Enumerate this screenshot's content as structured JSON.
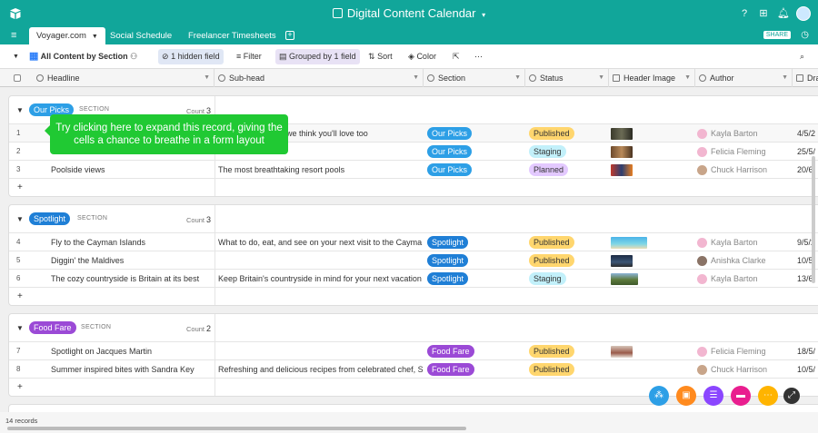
{
  "app": {
    "title": "Digital Content Calendar"
  },
  "tabs": [
    {
      "label": "Voyager.com",
      "active": true
    },
    {
      "label": "Social Schedule",
      "active": false
    },
    {
      "label": "Freelancer Timesheets",
      "active": false
    }
  ],
  "share_label": "SHARE",
  "toolbar": {
    "view_name": "All Content by Section",
    "hidden_fields": "1 hidden field",
    "filter": "Filter",
    "grouped": "Grouped by 1 field",
    "sort": "Sort",
    "color": "Color"
  },
  "columns": [
    "Headline",
    "Sub-head",
    "Section",
    "Status",
    "Header Image",
    "Author",
    "Dra"
  ],
  "group_section_label": "SECTION",
  "count_label": "Count",
  "groups": [
    {
      "name": "Our Picks",
      "color": "#2d9fe6",
      "count": "3",
      "rows": [
        {
          "num": "1",
          "headline": "",
          "subhead": "we think you'll love too",
          "section": "Our Picks",
          "status": "Published",
          "author": "Kayla Barton",
          "date": "4/5/2"
        },
        {
          "num": "2",
          "headline": "",
          "subhead": "",
          "section": "Our Picks",
          "status": "Staging",
          "author": "Felicia Fleming",
          "date": "25/5/"
        },
        {
          "num": "3",
          "headline": "Poolside views",
          "subhead": "The most breathtaking resort pools",
          "section": "Our Picks",
          "status": "Planned",
          "author": "Chuck Harrison",
          "date": "20/6/"
        }
      ]
    },
    {
      "name": "Spotlight",
      "color": "#1f7fd6",
      "count": "3",
      "rows": [
        {
          "num": "4",
          "headline": "Fly to the Cayman Islands",
          "subhead": "What to do, eat, and see on your next visit to the Cayma...",
          "section": "Spotlight",
          "status": "Published",
          "author": "Kayla Barton",
          "date": "9/5/2"
        },
        {
          "num": "5",
          "headline": "Diggin' the Maldives",
          "subhead": "",
          "section": "Spotlight",
          "status": "Published",
          "author": "Anishka Clarke",
          "date": "10/5/"
        },
        {
          "num": "6",
          "headline": "The cozy countryside is Britain at its best",
          "subhead": "Keep Britain's countryside in mind for your next vacation",
          "section": "Spotlight",
          "status": "Staging",
          "author": "Kayla Barton",
          "date": "13/6/"
        }
      ]
    },
    {
      "name": "Food Fare",
      "color": "#9b4ad6",
      "count": "2",
      "rows": [
        {
          "num": "7",
          "headline": "Spotlight on Jacques Martin",
          "subhead": "",
          "section": "Food Fare",
          "status": "Published",
          "author": "Felicia Fleming",
          "date": "18/5/"
        },
        {
          "num": "8",
          "headline": "Summer inspired bites with Sandra Key",
          "subhead": "Refreshing and delicious recipes from celebrated chef, S...",
          "section": "Food Fare",
          "status": "Published",
          "author": "Chuck Harrison",
          "date": "10/5/"
        }
      ]
    }
  ],
  "status_colors": {
    "Published": "#ffd66e",
    "Staging": "#c2f0fa",
    "Planned": "#e3c9ff"
  },
  "tooltip": "Try clicking here to expand this record, giving the cells a chance to breathe in a form layout",
  "records": "14 records",
  "colors": {
    "brand": "#11a69a",
    "tooltip": "#20c933"
  }
}
